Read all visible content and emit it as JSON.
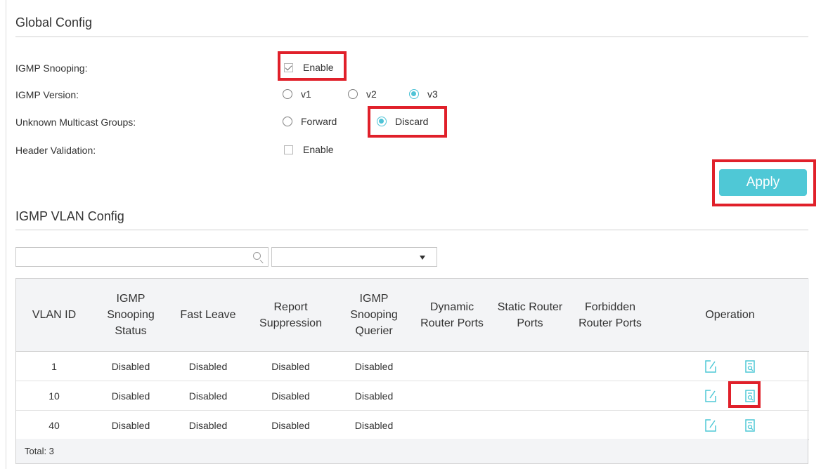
{
  "global_config": {
    "title": "Global Config",
    "igmp_snooping": {
      "label": "IGMP Snooping:",
      "option_label": "Enable",
      "checked": true
    },
    "igmp_version": {
      "label": "IGMP Version:",
      "options": [
        "v1",
        "v2",
        "v3"
      ],
      "selected": "v3"
    },
    "unknown_multicast": {
      "label": "Unknown Multicast Groups:",
      "options": [
        "Forward",
        "Discard"
      ],
      "selected": "Discard"
    },
    "header_validation": {
      "label": "Header Validation:",
      "option_label": "Enable",
      "checked": false
    },
    "apply_label": "Apply"
  },
  "vlan_config": {
    "title": "IGMP VLAN Config",
    "search": {
      "placeholder": "",
      "value": "",
      "icon": "search-icon"
    },
    "filter_select": {
      "value": ""
    },
    "columns": [
      "VLAN ID",
      "IGMP Snooping Status",
      "Fast Leave",
      "Report Suppression",
      "IGMP Snooping Querier",
      "Dynamic Router Ports",
      "Static Router Ports",
      "Forbidden Router Ports",
      "Operation"
    ],
    "rows": [
      {
        "vlan_id": "1",
        "snooping_status": "Disabled",
        "fast_leave": "Disabled",
        "report_suppression": "Disabled",
        "querier": "Disabled",
        "dynamic_ports": "",
        "static_ports": "",
        "forbidden_ports": ""
      },
      {
        "vlan_id": "10",
        "snooping_status": "Disabled",
        "fast_leave": "Disabled",
        "report_suppression": "Disabled",
        "querier": "Disabled",
        "dynamic_ports": "",
        "static_ports": "",
        "forbidden_ports": ""
      },
      {
        "vlan_id": "40",
        "snooping_status": "Disabled",
        "fast_leave": "Disabled",
        "report_suppression": "Disabled",
        "querier": "Disabled",
        "dynamic_ports": "",
        "static_ports": "",
        "forbidden_ports": ""
      }
    ],
    "operation_icons": [
      "edit-icon",
      "view-detail-icon"
    ],
    "total_label": "Total: 3"
  },
  "colors": {
    "accent": "#4fc8d6",
    "highlight": "#e0202a"
  }
}
